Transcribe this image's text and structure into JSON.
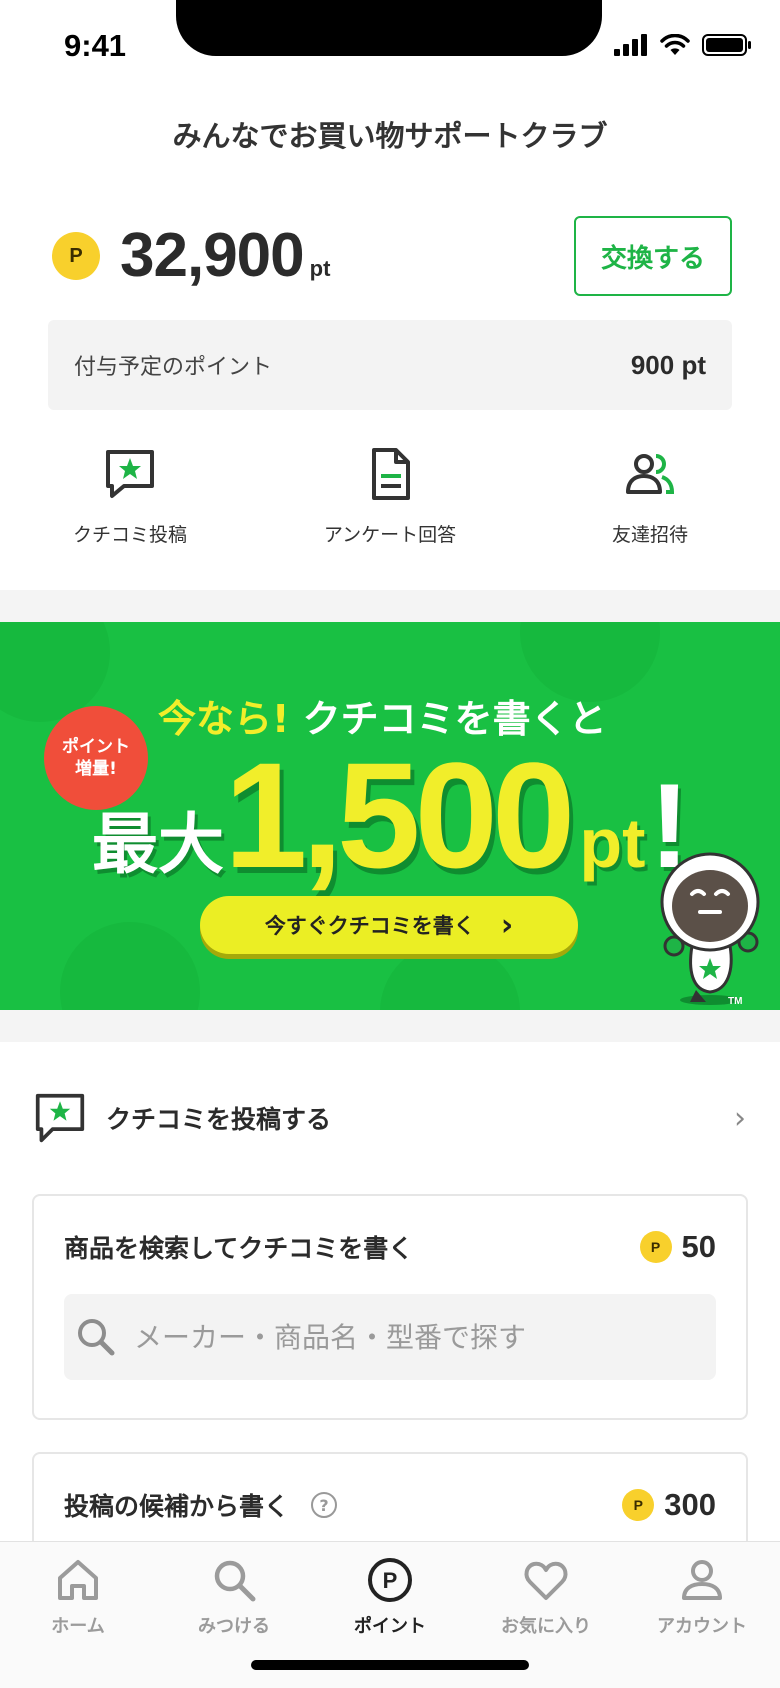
{
  "status_bar": {
    "time": "9:41"
  },
  "header": {
    "title": "みんなでお買い物サポートクラブ"
  },
  "points": {
    "coin_glyph": "P",
    "value": "32,900",
    "unit": "pt",
    "exchange_label": "交換する",
    "pending_label": "付与予定のポイント",
    "pending_value": "900 pt"
  },
  "actions": [
    {
      "label": "クチコミ投稿",
      "icon": "review-chat-star-icon"
    },
    {
      "label": "アンケート回答",
      "icon": "survey-document-icon"
    },
    {
      "label": "友達招待",
      "icon": "invite-friends-icon"
    }
  ],
  "banner": {
    "badge": "ポイント\n増量!",
    "line1_yellow": "今なら!",
    "line1_white": "クチコミを書くと",
    "max_label": "最大",
    "amount": "1,500",
    "unit": "pt",
    "exclaim": "!",
    "button_label": "今すぐクチコミを書く",
    "button_chevron": "›",
    "mascot_tm": "TM"
  },
  "review_section": {
    "title": "クチコミを投稿する",
    "chevron": "›",
    "search_card": {
      "title": "商品を検索してクチコミを書く",
      "points": "50",
      "search_placeholder": "メーカー・商品名・型番で探す"
    },
    "candidate_card": {
      "title": "投稿の候補から書く",
      "help": "?",
      "points": "300"
    }
  },
  "tabbar": {
    "items": [
      {
        "label": "ホーム",
        "icon": "home-icon",
        "active": false
      },
      {
        "label": "みつける",
        "icon": "search-icon",
        "active": false
      },
      {
        "label": "ポイント",
        "icon": "point-icon",
        "active": true
      },
      {
        "label": "お気に入り",
        "icon": "heart-icon",
        "active": false
      },
      {
        "label": "アカウント",
        "icon": "account-icon",
        "active": false
      }
    ]
  },
  "colors": {
    "accent_green": "#1eb446",
    "banner_green": "#19c043",
    "banner_yellow": "#f1ee2a",
    "coin_yellow": "#f8d02c",
    "badge_red": "#f04e3a"
  }
}
